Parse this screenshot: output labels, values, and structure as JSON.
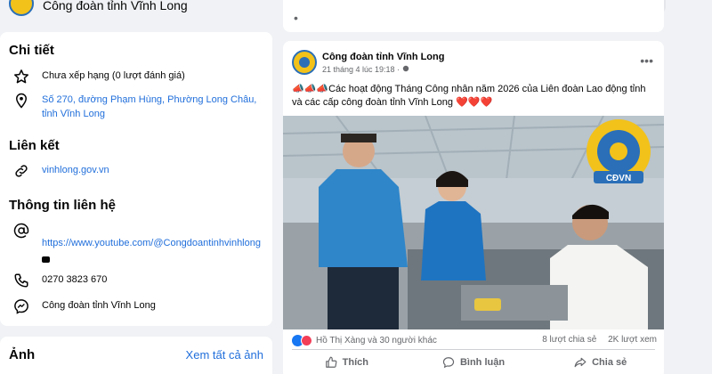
{
  "page": {
    "title": "Công đoàn tỉnh Vĩnh Long",
    "more_label": "···"
  },
  "details": {
    "title": "Chi tiết",
    "rating": "Chưa xếp hạng (0 lượt đánh giá)",
    "address": "Số 270, đường Phạm Hùng, Phường Long Châu, tỉnh Vĩnh Long"
  },
  "links": {
    "title": "Liên kết",
    "website": "vinhlong.gov.vn"
  },
  "contact": {
    "title": "Thông tin liên hệ",
    "youtube": "https://www.youtube.com/@Congdoantinhvinhlong",
    "phone": "0270 3823 670",
    "messenger": "Công đoàn tỉnh Vĩnh Long"
  },
  "photos": {
    "title": "Ảnh",
    "see_all": "Xem tất cả ảnh"
  },
  "post": {
    "author": "Công đoàn tỉnh Vĩnh Long",
    "time": "21 tháng 4 lúc 19:18 · ",
    "text": "📣📣📣Các hoạt động Tháng Công nhân năm 2026 của Liên đoàn Lao động tỉnh và các cấp công đoàn tỉnh Vĩnh Long ❤️❤️❤️",
    "logo_text": "CĐVN",
    "reactions": "Hồ Thị Xàng và 30 người khác",
    "shares": "8 lượt chia sẻ",
    "views": "2K lượt xem",
    "like": "Thích",
    "comment": "Bình luận",
    "share": "Chia sẻ"
  },
  "colors": {
    "link": "#216fdb",
    "accent": "#1877f2",
    "love": "#f33e58"
  }
}
